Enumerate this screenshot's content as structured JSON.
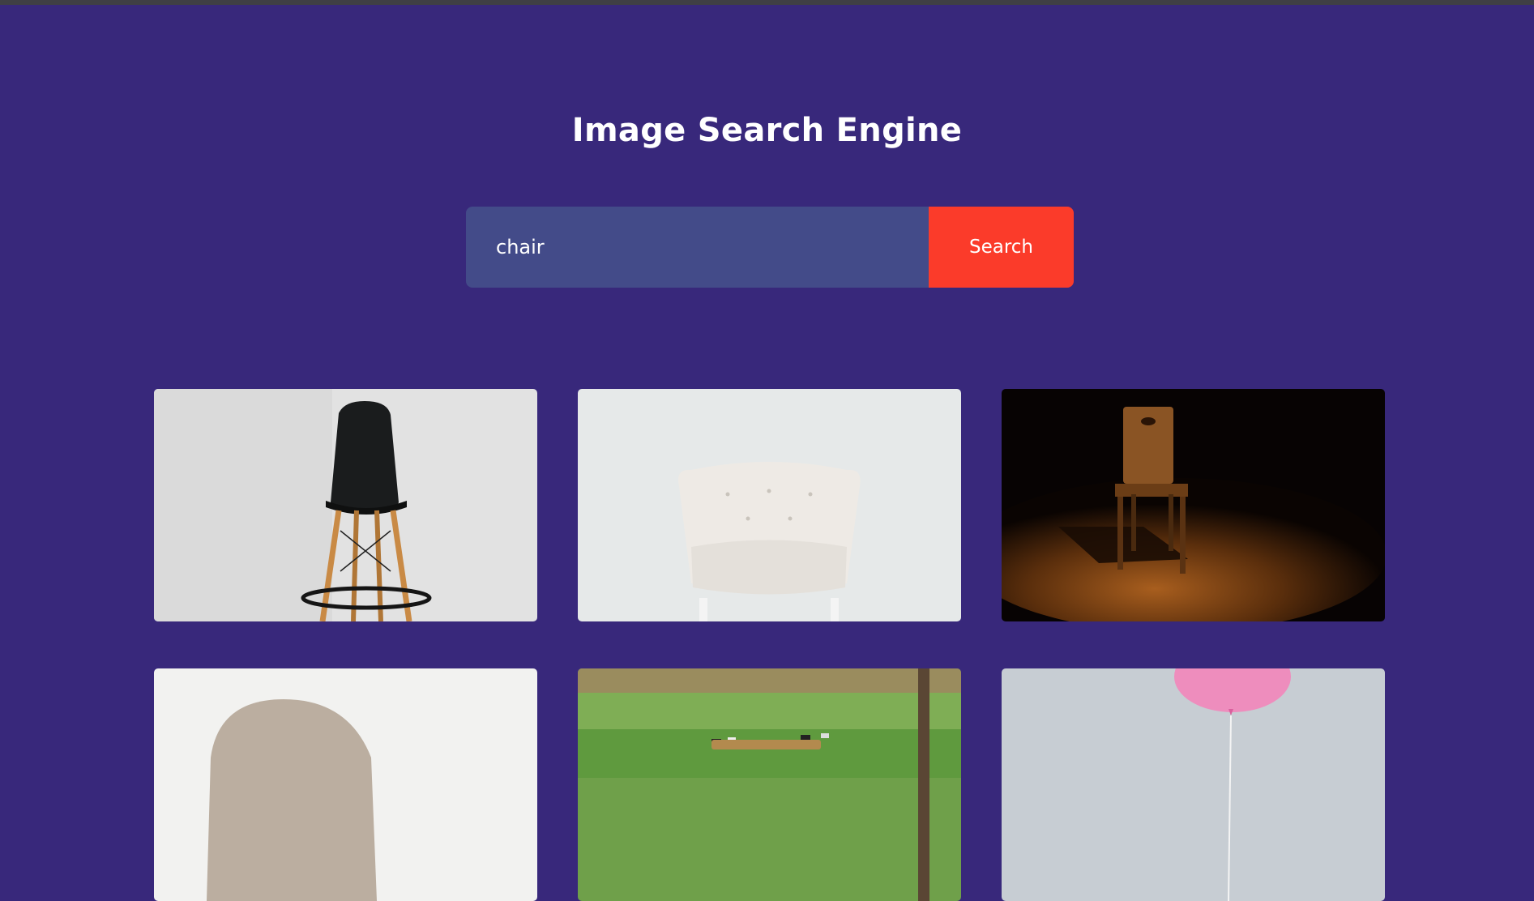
{
  "header": {
    "title": "Image Search Engine"
  },
  "search": {
    "value": "chair",
    "button_label": "Search"
  },
  "results": [
    {
      "subject": "black plastic bar stool with wooden legs"
    },
    {
      "subject": "white tufted armchair"
    },
    {
      "subject": "wooden chair in spotlight on stage"
    },
    {
      "subject": "beige upholstered chair"
    },
    {
      "subject": "wooden bench in green field with cows"
    },
    {
      "subject": "chair with pink balloon"
    }
  ]
}
